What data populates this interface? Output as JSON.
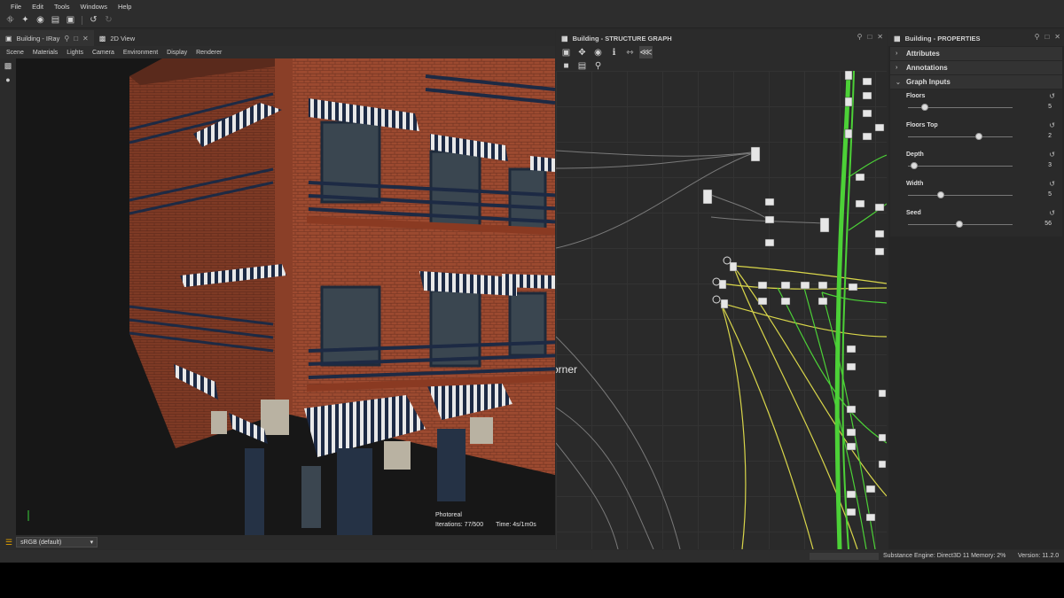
{
  "menu": [
    "File",
    "Edit",
    "Tools",
    "Windows",
    "Help"
  ],
  "toolbar_icons": [
    "new-graph-icon",
    "new-function-icon",
    "open-icon",
    "folder-icon",
    "save-icon",
    "undo-icon",
    "redo-icon"
  ],
  "viewport": {
    "tab_title": "Building - IRay",
    "tab2_title": "2D View",
    "menu": [
      "Scene",
      "Materials",
      "Lights",
      "Camera",
      "Environment",
      "Display",
      "Renderer"
    ],
    "mode": "Photoreal",
    "iterations": "Iterations: 77/500",
    "time": "Time: 4s/1m0s",
    "color_space": "sRGB (default)"
  },
  "graph": {
    "tab_title": "Building - STRUCTURE GRAPH",
    "frame_label": "orner"
  },
  "properties": {
    "tab_title": "Building - PROPERTIES",
    "sections": [
      "Attributes",
      "Annotations",
      "Graph Inputs"
    ],
    "params": [
      {
        "label": "Floors",
        "value": "5",
        "fraction": 0.16
      },
      {
        "label": "Floors Top",
        "value": "2",
        "fraction": 0.68
      },
      {
        "label": "Depth",
        "value": "3",
        "fraction": 0.06
      },
      {
        "label": "Width",
        "value": "5",
        "fraction": 0.31
      },
      {
        "label": "Seed",
        "value": "56",
        "fraction": 0.49
      }
    ]
  },
  "status": {
    "engine": "Substance Engine: Direct3D 11 Memory: 2%",
    "version": "Version: 11.2.0"
  },
  "colors": {
    "panel_bg": "#2a2a2a",
    "wire_green": "#4cd137",
    "wire_yellow": "#d9d64a",
    "brick": "#a0482e",
    "awning_navy": "#1d2a44"
  }
}
